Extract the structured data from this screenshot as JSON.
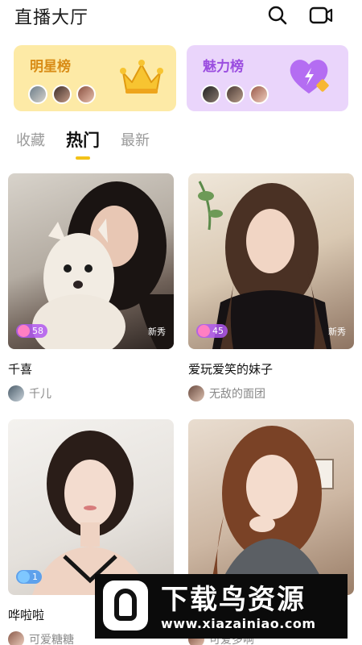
{
  "header": {
    "title": "直播大厅",
    "search_icon": "search-icon",
    "live_icon": "video-camera-icon"
  },
  "rank_cards": [
    {
      "title": "明星榜",
      "icon": "crown-icon",
      "bg": "#fdeaa6",
      "text_color": "#d98c16"
    },
    {
      "title": "魅力榜",
      "icon": "purple-heart-icon",
      "bg": "#ead5fb",
      "text_color": "#9b4ee0"
    }
  ],
  "tabs": [
    {
      "label": "收藏",
      "active": false
    },
    {
      "label": "热门",
      "active": true
    },
    {
      "label": "最新",
      "active": false
    }
  ],
  "accent_color": "#f3c218",
  "rooms": [
    {
      "title": "千喜",
      "host": "千儿",
      "hot": "58",
      "tag": "新秀"
    },
    {
      "title": "爱玩爱笑的妹子",
      "host": "无敌的面团",
      "hot": "45",
      "tag": "新秀"
    },
    {
      "title": "哗啦啦",
      "host": "可爱糖糖",
      "hot": "1",
      "tag": ""
    },
    {
      "title": "",
      "host": "可爱多啊",
      "hot": "",
      "tag": ""
    }
  ],
  "watermark": {
    "title": "下载鸟资源",
    "url": "www.xiazainiao.com"
  }
}
